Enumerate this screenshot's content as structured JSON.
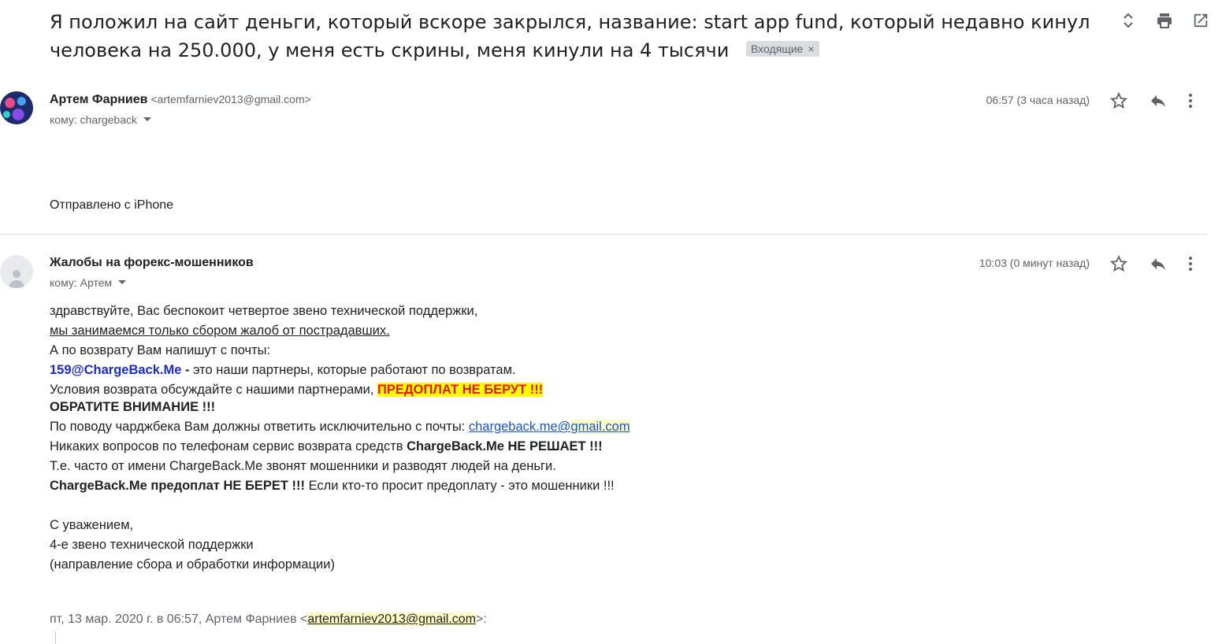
{
  "thread": {
    "subject": "Я положил на сайт деньги, который вскоре закрылся, название: start app fund, который недавно кинул человека на 250.000, у меня есть скрины, меня кинули на 4 тысячи",
    "label": "Входящие",
    "label_remove": "×",
    "icons": [
      "expand-collapse-icon",
      "print-icon",
      "open-in-new-window-icon"
    ]
  },
  "message1": {
    "sender_name": "Артем Фарниев",
    "sender_email": "<artemfarniev2013@gmail.com>",
    "to": "кому: chargeback",
    "time": "06:57 (3 часа назад)",
    "body": "Отправлено с iPhone"
  },
  "message2": {
    "sender_name": "Жалобы на форекс-мошенников",
    "to": "кому: Артем",
    "time": "10:03 (0 минут назад)",
    "lines": {
      "l1": "здравствуйте, Вас беспокоит четвертое звено технической поддержки,",
      "l2": "мы занимаемся только сбором жалоб от пострадавших.",
      "l3": "А по возврату Вам напишут с почты:",
      "l4_email": "159@ChargeBack.Me",
      "l4_dash": " - ",
      "l4_rest": "это наши партнеры, которые работают по возвратам.",
      "l5_text": "Условия возврата обсуждайте с нашими партнерами, ",
      "l5_hl": "ПРЕДОПЛАТ НЕ БЕРУТ !!!",
      "l6": "ОБРАТИТЕ ВНИМАНИЕ !!!",
      "l7_text": "По поводу чарджбека Вам должны ответить исключительно с почты: ",
      "l7_link_a": "chargeback.me@",
      "l7_link_b": "gmail.com",
      "l8_text": "Никаких вопросов по телефонам сервис возврата средств ",
      "l8_bold": "ChargeBack.Me НЕ РЕШАЕТ !!!",
      "l9": "Т.е. часто от имени ChargeBack.Me звонят мошенники и разводят людей на деньги.",
      "l10_bold": "ChargeBack.Me предоплат НЕ БЕРЕТ !!!",
      "l10_text": " Если кто-то просит предоплату - это мошенники !!!",
      "sig1": "С уважением,",
      "sig2": "4-е звено технической поддержки",
      "sig3": "(направление сбора и обработки информации)"
    },
    "quote_prefix": "пт, 13 мар. 2020 г. в 06:57, Артем Фарниев <",
    "quote_email": "artemfarniev2013@gmail.com",
    "quote_suffix": ">:"
  },
  "colors": {
    "highlight_yellow": "#fffb00",
    "alert_red": "#e01b1b",
    "link_blue": "#1a55c8",
    "email_blue": "#1a2bd1"
  }
}
